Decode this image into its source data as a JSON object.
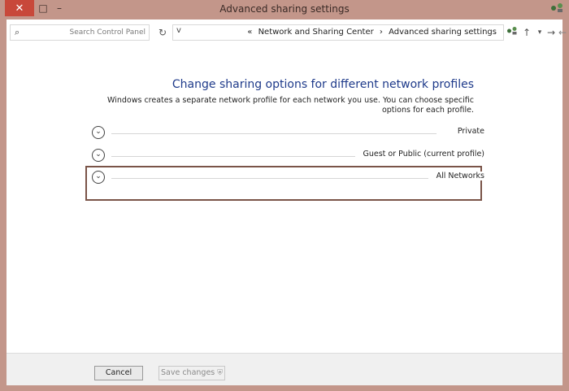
{
  "window": {
    "title": "Advanced sharing settings",
    "close_glyph": "✕",
    "maximize_glyph": "□",
    "minimize_glyph": "–",
    "app_icon": "network-icon"
  },
  "navbar": {
    "search_placeholder": "Search Control Panel",
    "breadcrumb": [
      "Network and Sharing Center",
      "Advanced sharing settings"
    ],
    "breadcrumb_prefix": "«",
    "separator": "›",
    "dropdown_glyph": "v",
    "refresh_glyph": "↻",
    "up_glyph": "↑",
    "recent_glyph": "▾",
    "back_glyph": "←",
    "forward_glyph": "→",
    "location_icon": "network-icon"
  },
  "main": {
    "heading": "Change sharing options for different network profiles",
    "description": "Windows creates a separate network profile for each network you use. You can choose specific options for each profile.",
    "sections": [
      {
        "label": "Private",
        "expand_glyph": "⌄"
      },
      {
        "label": "Guest or Public (current profile)",
        "expand_glyph": "⌄"
      },
      {
        "label": "All Networks",
        "expand_glyph": "⌄"
      }
    ]
  },
  "footer": {
    "save_label": "Save changes",
    "cancel_label": "Cancel"
  },
  "colors": {
    "frame": "#c3968a",
    "heading": "#1e3a8a",
    "close": "#c8483a",
    "highlight": "#7a5448"
  }
}
